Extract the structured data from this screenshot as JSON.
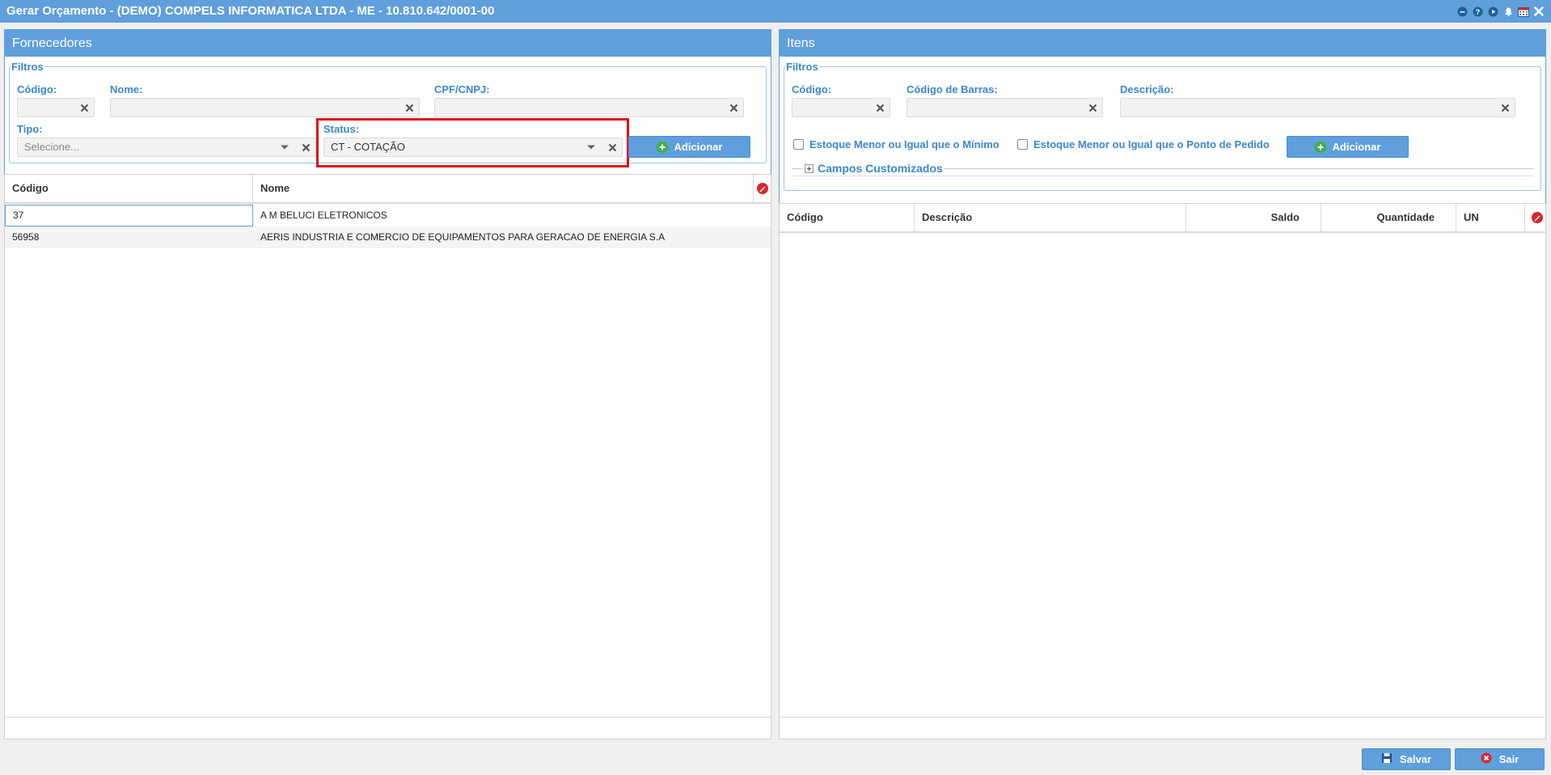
{
  "window": {
    "title": "Gerar Orçamento - (DEMO) COMPELS INFORMATICA LTDA - ME - 10.810.642/0001-00",
    "icons": [
      "minimize-icon",
      "help-icon",
      "play-icon",
      "bell-icon",
      "calendar-icon",
      "close-icon"
    ]
  },
  "fornecedores": {
    "header": "Fornecedores",
    "filtros": {
      "legend": "Filtros",
      "codigo": {
        "label": "Código:",
        "value": ""
      },
      "nome": {
        "label": "Nome:",
        "value": ""
      },
      "cpf_cnpj": {
        "label": "CPF/CNPJ:",
        "value": ""
      },
      "tipo": {
        "label": "Tipo:",
        "placeholder": "Selecione..."
      },
      "status": {
        "label": "Status:",
        "value": "CT - COTAÇÃO"
      },
      "add_button": "Adicionar"
    },
    "grid": {
      "columns": [
        "Código",
        "Nome"
      ],
      "rows": [
        {
          "codigo": "37",
          "nome": "A M BELUCI ELETRONICOS"
        },
        {
          "codigo": "56958",
          "nome": "AERIS INDUSTRIA E COMERCIO DE EQUIPAMENTOS PARA GERACAO DE ENERGIA S.A"
        }
      ]
    }
  },
  "itens": {
    "header": "Itens",
    "filtros": {
      "legend": "Filtros",
      "codigo": {
        "label": "Código:",
        "value": ""
      },
      "codigo_barras": {
        "label": "Código de Barras:",
        "value": ""
      },
      "descricao": {
        "label": "Descrição:",
        "value": ""
      },
      "chk_minimo": {
        "label": "Estoque Menor ou Igual que o Mínimo",
        "checked": false
      },
      "chk_ponto_pedido": {
        "label": "Estoque Menor ou Igual que o Ponto de Pedido",
        "checked": false
      },
      "add_button": "Adicionar",
      "campos_customizados": "Campos Customizados"
    },
    "grid": {
      "columns": [
        "Código",
        "Descrição",
        "Saldo",
        "Quantidade",
        "UN"
      ],
      "rows": []
    }
  },
  "footer": {
    "salvar": "Salvar",
    "sair": "Sair"
  },
  "colors": {
    "accent": "#5f9fdc",
    "label": "#3a87d0",
    "highlight": "#e01010",
    "add_icon": "#3cb043",
    "remove_icon": "#d9262c"
  }
}
